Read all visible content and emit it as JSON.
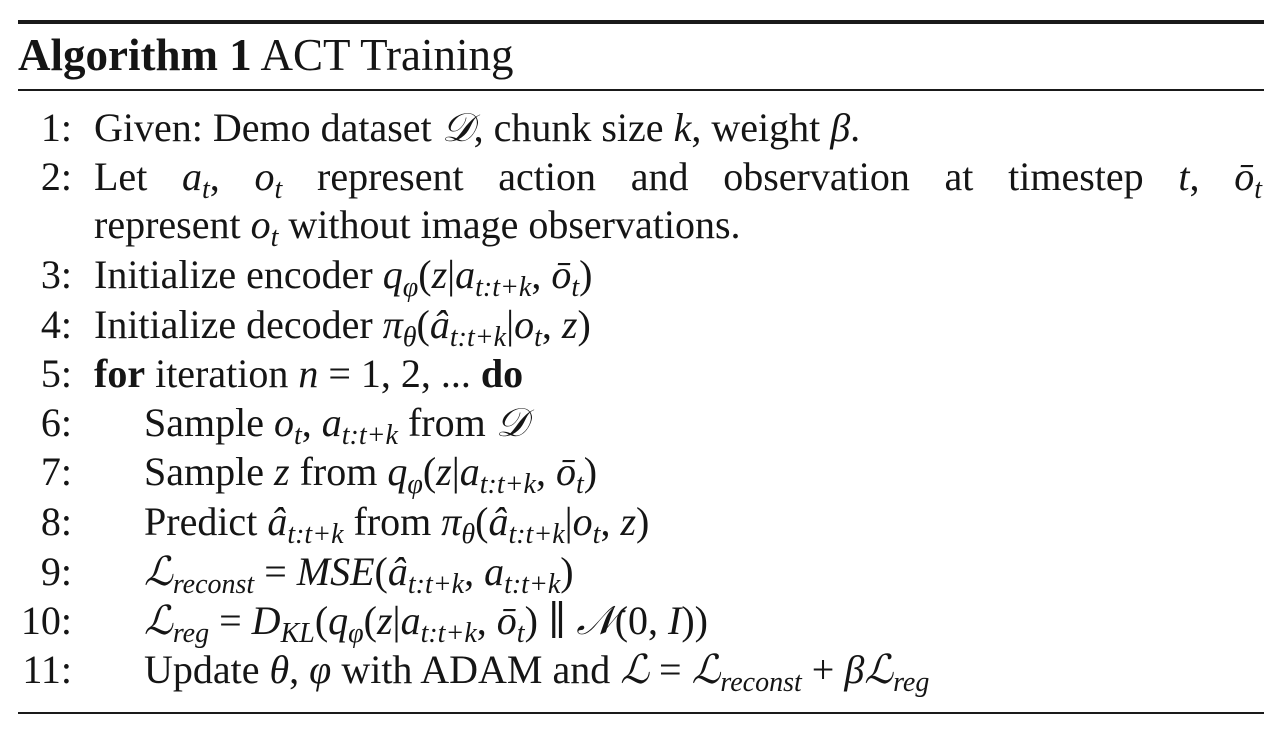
{
  "algorithm": {
    "label": "Algorithm 1",
    "title": "ACT Training",
    "lines": [
      {
        "num": "1:",
        "text": "Given: Demo dataset 𝒟, chunk size k, weight β."
      },
      {
        "num": "2:",
        "text": "Let aₜ, oₜ represent action and observation at timestep t, ōₜ"
      },
      {
        "num": "",
        "text": "represent oₜ without image observations."
      },
      {
        "num": "3:",
        "text": "Initialize encoder q_φ(z|a_{t:t+k}, ōₜ)"
      },
      {
        "num": "4:",
        "text": "Initialize decoder π_θ(â_{t:t+k}|oₜ, z)"
      },
      {
        "num": "5:",
        "text": "for iteration n = 1, 2, ... do"
      },
      {
        "num": "6:",
        "text": "Sample oₜ, a_{t:t+k} from 𝒟"
      },
      {
        "num": "7:",
        "text": "Sample z from q_φ(z|a_{t:t+k}, ōₜ)"
      },
      {
        "num": "8:",
        "text": "Predict â_{t:t+k} from π_θ(â_{t:t+k}|oₜ, z)"
      },
      {
        "num": "9:",
        "text": "ℒ_reconst = MSE(â_{t:t+k}, a_{t:t+k})"
      },
      {
        "num": "10:",
        "text": "ℒ_reg = D_KL(q_φ(z|a_{t:t+k}, ōₜ) ∥ 𝒩(0, I))"
      },
      {
        "num": "11:",
        "text": "Update θ, φ with ADAM and ℒ = ℒ_reconst + βℒ_reg"
      }
    ]
  }
}
